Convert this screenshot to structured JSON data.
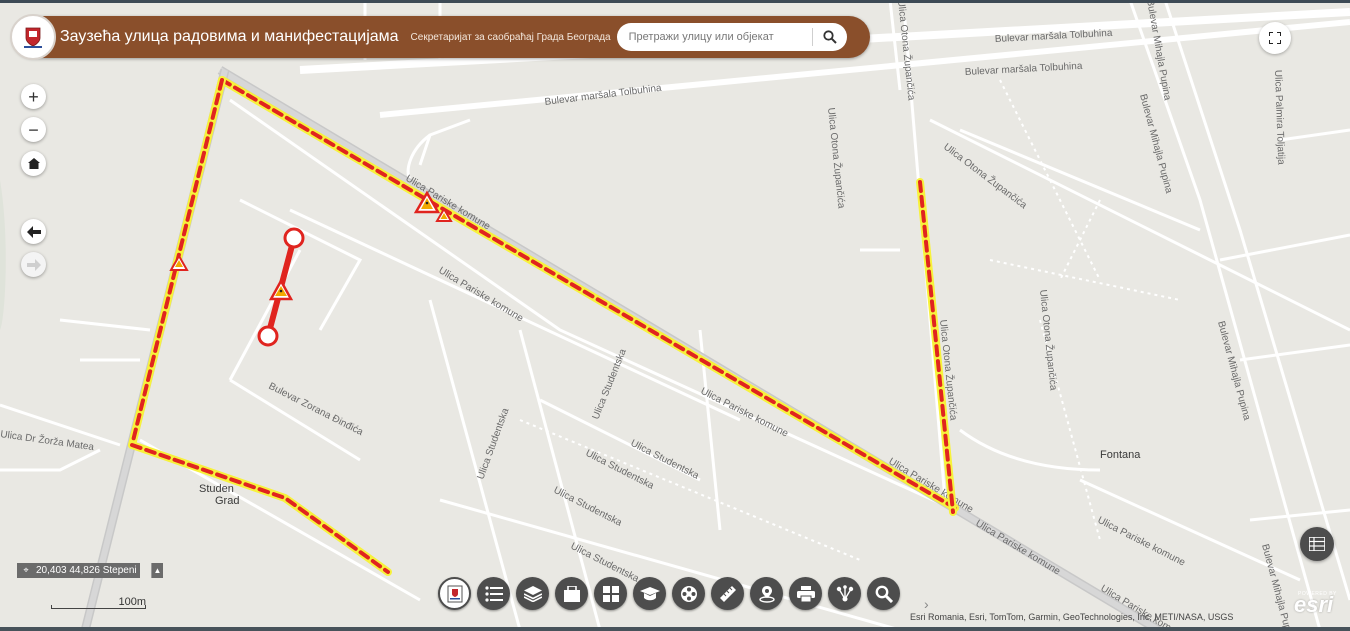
{
  "header": {
    "title": "Заузећа улица радовима и манифестацијама",
    "subtitle": "Секретаријат за саобраћај Града Београда",
    "search_placeholder": "Претражи улицу или објекат"
  },
  "controls": {
    "zoom_in": "+",
    "zoom_out": "−"
  },
  "map_labels": {
    "bulevar_tolbuhina_1": "Bulevar maršala Tolbuhina",
    "bulevar_tolbuhina_2": "Bulevar maršala Tolbuhina",
    "bulevar_tolbuhina_3": "Bulevar maršala Tolbuhina",
    "pariske_komune_1": "Ulica Pariske komune",
    "pariske_komune_2": "Ulica Pariske komune",
    "pariske_komune_3": "Ulica Pariske komune",
    "pariske_komune_4": "Ulica Pariske komune",
    "pariske_komune_5": "Ulica Pariske komune",
    "pariske_komune_6": "Ulica Pariske komune",
    "pariske_komune_7": "Ulica Pariske komune",
    "studentska_1": "Ulica Studentska",
    "studentska_2": "Ulica Studentska",
    "studentska_3": "Ulica Studentska",
    "studentska_4": "Ulica Studentska",
    "studentska_5": "Ulica Studentska",
    "studentska_6": "Ulica Studentska",
    "zorana_djindjica": "Bulevar Zorana Đinđića",
    "dr_zorza_mateа": "Ulica Dr Žorža Matea",
    "otona_zupancica_1": "Ulica Otona Župančića",
    "otona_zupancica_2": "Ulica Otona Župančića",
    "otona_zupancica_3": "Ulica Otona Župančića",
    "otona_zupancica_4": "Ulica Otona Župančića",
    "otona_zupancica_5": "Ulica Otona Župančića",
    "mihajla_pupina_1": "Bulevar Mihajla Pupina",
    "mihajla_pupina_2": "Bulevar Mihajla Pupina",
    "mihajla_pupina_3": "Bulevar Mihajla Pupina",
    "mihajla_pupina_4": "Bulevar Mihajla Pupina",
    "palmira_toljatija": "Ulica Palmira Toljatija",
    "fontana": "Fontana",
    "studentski_grad_1": "Studen",
    "studentski_grad_2": "Grad"
  },
  "coordinates": {
    "value": "20,403 44,826 Stepeni"
  },
  "scale": {
    "label": "100m"
  },
  "toolbar": {
    "buttons": [
      "logo-icon",
      "list-icon",
      "layers-icon",
      "basemap-gallery-icon",
      "grid-icon",
      "graduation-icon",
      "film-reel-icon",
      "ruler-icon",
      "location-icon",
      "print-icon",
      "share-icon",
      "search-icon"
    ]
  },
  "attribution": "Esri Romania, Esri, TomTom, Garmin, GeoTechnologies, Inc, METI/NASA, USGS",
  "esri_logo": "esri",
  "esri_powered": "POWERED BY",
  "colors": {
    "header_bg": "#8a4f2b",
    "closure_yellow": "#f7f23c",
    "closure_red": "#e0241f",
    "button_dark": "#4d4d4d",
    "map_bg": "#e9e8e3"
  }
}
